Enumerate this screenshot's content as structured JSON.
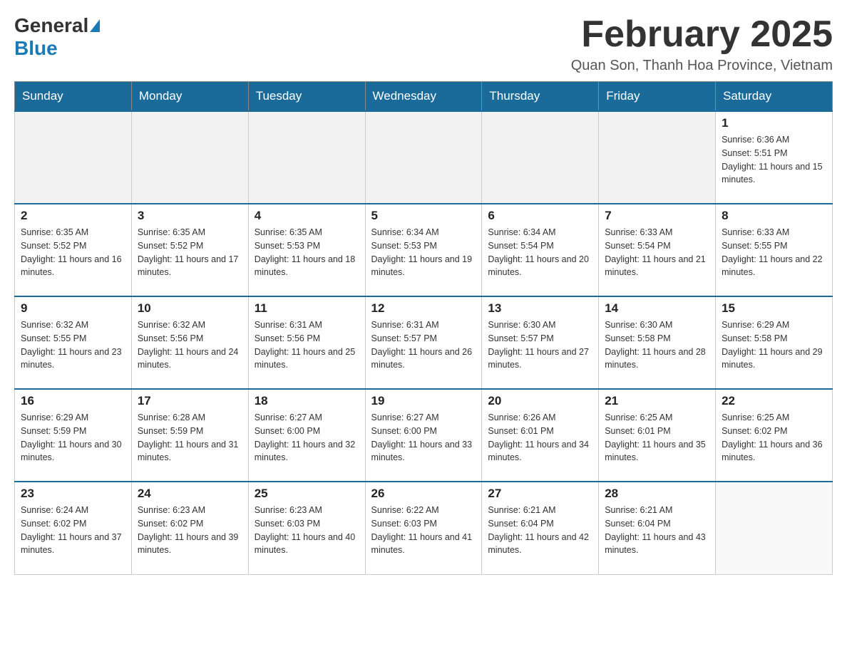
{
  "header": {
    "logo_general": "General",
    "logo_blue": "Blue",
    "month_title": "February 2025",
    "location": "Quan Son, Thanh Hoa Province, Vietnam"
  },
  "weekdays": [
    "Sunday",
    "Monday",
    "Tuesday",
    "Wednesday",
    "Thursday",
    "Friday",
    "Saturday"
  ],
  "weeks": [
    [
      {
        "day": "",
        "info": ""
      },
      {
        "day": "",
        "info": ""
      },
      {
        "day": "",
        "info": ""
      },
      {
        "day": "",
        "info": ""
      },
      {
        "day": "",
        "info": ""
      },
      {
        "day": "",
        "info": ""
      },
      {
        "day": "1",
        "info": "Sunrise: 6:36 AM\nSunset: 5:51 PM\nDaylight: 11 hours and 15 minutes."
      }
    ],
    [
      {
        "day": "2",
        "info": "Sunrise: 6:35 AM\nSunset: 5:52 PM\nDaylight: 11 hours and 16 minutes."
      },
      {
        "day": "3",
        "info": "Sunrise: 6:35 AM\nSunset: 5:52 PM\nDaylight: 11 hours and 17 minutes."
      },
      {
        "day": "4",
        "info": "Sunrise: 6:35 AM\nSunset: 5:53 PM\nDaylight: 11 hours and 18 minutes."
      },
      {
        "day": "5",
        "info": "Sunrise: 6:34 AM\nSunset: 5:53 PM\nDaylight: 11 hours and 19 minutes."
      },
      {
        "day": "6",
        "info": "Sunrise: 6:34 AM\nSunset: 5:54 PM\nDaylight: 11 hours and 20 minutes."
      },
      {
        "day": "7",
        "info": "Sunrise: 6:33 AM\nSunset: 5:54 PM\nDaylight: 11 hours and 21 minutes."
      },
      {
        "day": "8",
        "info": "Sunrise: 6:33 AM\nSunset: 5:55 PM\nDaylight: 11 hours and 22 minutes."
      }
    ],
    [
      {
        "day": "9",
        "info": "Sunrise: 6:32 AM\nSunset: 5:55 PM\nDaylight: 11 hours and 23 minutes."
      },
      {
        "day": "10",
        "info": "Sunrise: 6:32 AM\nSunset: 5:56 PM\nDaylight: 11 hours and 24 minutes."
      },
      {
        "day": "11",
        "info": "Sunrise: 6:31 AM\nSunset: 5:56 PM\nDaylight: 11 hours and 25 minutes."
      },
      {
        "day": "12",
        "info": "Sunrise: 6:31 AM\nSunset: 5:57 PM\nDaylight: 11 hours and 26 minutes."
      },
      {
        "day": "13",
        "info": "Sunrise: 6:30 AM\nSunset: 5:57 PM\nDaylight: 11 hours and 27 minutes."
      },
      {
        "day": "14",
        "info": "Sunrise: 6:30 AM\nSunset: 5:58 PM\nDaylight: 11 hours and 28 minutes."
      },
      {
        "day": "15",
        "info": "Sunrise: 6:29 AM\nSunset: 5:58 PM\nDaylight: 11 hours and 29 minutes."
      }
    ],
    [
      {
        "day": "16",
        "info": "Sunrise: 6:29 AM\nSunset: 5:59 PM\nDaylight: 11 hours and 30 minutes."
      },
      {
        "day": "17",
        "info": "Sunrise: 6:28 AM\nSunset: 5:59 PM\nDaylight: 11 hours and 31 minutes."
      },
      {
        "day": "18",
        "info": "Sunrise: 6:27 AM\nSunset: 6:00 PM\nDaylight: 11 hours and 32 minutes."
      },
      {
        "day": "19",
        "info": "Sunrise: 6:27 AM\nSunset: 6:00 PM\nDaylight: 11 hours and 33 minutes."
      },
      {
        "day": "20",
        "info": "Sunrise: 6:26 AM\nSunset: 6:01 PM\nDaylight: 11 hours and 34 minutes."
      },
      {
        "day": "21",
        "info": "Sunrise: 6:25 AM\nSunset: 6:01 PM\nDaylight: 11 hours and 35 minutes."
      },
      {
        "day": "22",
        "info": "Sunrise: 6:25 AM\nSunset: 6:02 PM\nDaylight: 11 hours and 36 minutes."
      }
    ],
    [
      {
        "day": "23",
        "info": "Sunrise: 6:24 AM\nSunset: 6:02 PM\nDaylight: 11 hours and 37 minutes."
      },
      {
        "day": "24",
        "info": "Sunrise: 6:23 AM\nSunset: 6:02 PM\nDaylight: 11 hours and 39 minutes."
      },
      {
        "day": "25",
        "info": "Sunrise: 6:23 AM\nSunset: 6:03 PM\nDaylight: 11 hours and 40 minutes."
      },
      {
        "day": "26",
        "info": "Sunrise: 6:22 AM\nSunset: 6:03 PM\nDaylight: 11 hours and 41 minutes."
      },
      {
        "day": "27",
        "info": "Sunrise: 6:21 AM\nSunset: 6:04 PM\nDaylight: 11 hours and 42 minutes."
      },
      {
        "day": "28",
        "info": "Sunrise: 6:21 AM\nSunset: 6:04 PM\nDaylight: 11 hours and 43 minutes."
      },
      {
        "day": "",
        "info": ""
      }
    ]
  ]
}
